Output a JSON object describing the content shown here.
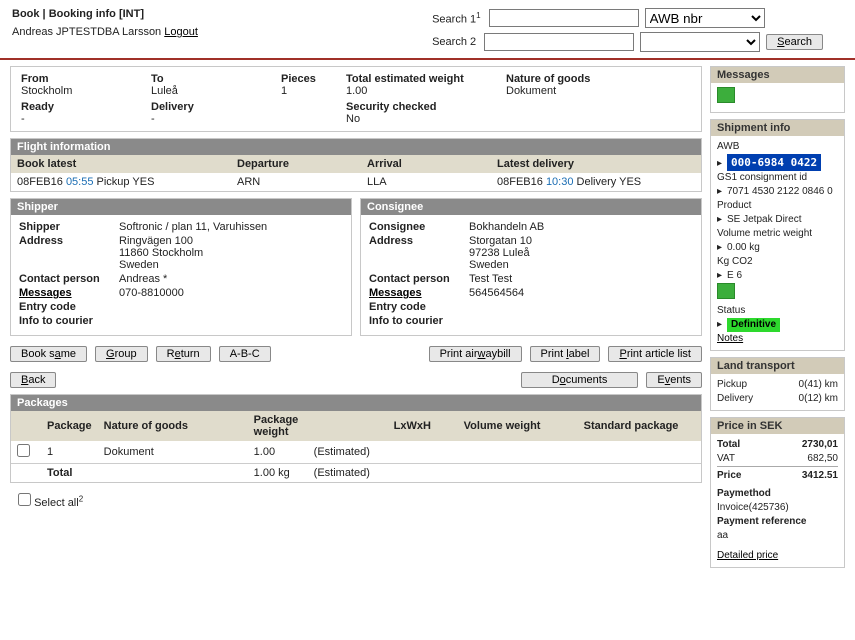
{
  "header": {
    "title": "Book | Booking info [INT]",
    "user": "Andreas JPTESTDBA Larsson",
    "logout": "Logout",
    "search1_label": "Search 1",
    "search2_label": "Search 2",
    "search1_sup": "1",
    "awb_option": "AWB nbr",
    "search_btn": "Search"
  },
  "overview": {
    "from_l": "From",
    "from_v": "Stockholm",
    "to_l": "To",
    "to_v": "Luleå",
    "pieces_l": "Pieces",
    "pieces_v": "1",
    "weight_l": "Total estimated weight",
    "weight_v": "1.00",
    "nature_l": "Nature of goods",
    "nature_v": "Dokument",
    "ready_l": "Ready",
    "ready_v": "-",
    "delivery_l": "Delivery",
    "delivery_v": "-",
    "sec_l": "Security checked",
    "sec_v": "No"
  },
  "flight": {
    "hdr": "Flight information",
    "book_l": "Book latest",
    "dep_l": "Departure",
    "arr_l": "Arrival",
    "lat_l": "Latest delivery",
    "book_date": "08FEB16",
    "book_time": "05:55",
    "book_tail": "Pickup YES",
    "dep_v": "ARN",
    "arr_v": "LLA",
    "lat_date": "08FEB16",
    "lat_time": "10:30",
    "lat_tail": "Delivery YES"
  },
  "shipper": {
    "hdr": "Shipper",
    "shipper_l": "Shipper",
    "shipper_v": "Softronic / plan 11, Varuhissen",
    "addr_l": "Address",
    "addr1": "Ringvägen 100",
    "addr2": "11860 Stockholm",
    "addr3": "Sweden",
    "contact_l": "Contact person",
    "contact_v": "Andreas *",
    "msgs_l": "Messages",
    "phone_v": "070-8810000",
    "entry_l": "Entry code",
    "info_l": "Info to courier"
  },
  "consignee": {
    "hdr": "Consignee",
    "consignee_l": "Consignee",
    "consignee_v": "Bokhandeln AB",
    "addr_l": "Address",
    "addr1": "Storgatan 10",
    "addr2": "97238 Luleå",
    "addr3": "Sweden",
    "contact_l": "Contact person",
    "contact_v": "Test Test",
    "msgs_l": "Messages",
    "phone_v": "564564564",
    "entry_l": "Entry code",
    "info_l": "Info to courier"
  },
  "btns": {
    "booksame": "Book same",
    "group": "Group",
    "return": "Return",
    "abc": "A-B-C",
    "back": "Back",
    "airwaybill": "Print airwaybill",
    "label": "Print label",
    "articles": "Print article list",
    "documents": "Documents",
    "events": "Events"
  },
  "packages": {
    "hdr": "Packages",
    "col_pkg": "Package",
    "col_nat": "Nature of goods",
    "col_wt": "Package weight",
    "col_lwh": "LxWxH",
    "col_vol": "Volume weight",
    "col_std": "Standard package",
    "row_no": "1",
    "row_nat": "Dokument",
    "row_wt": "1.00",
    "row_est": "(Estimated)",
    "tot_l": "Total",
    "tot_wt": "1.00 kg",
    "tot_est": "(Estimated)",
    "selectall": "Select all",
    "selectall_sup": "2"
  },
  "right": {
    "messages_hdr": "Messages",
    "ship_hdr": "Shipment info",
    "awb_l": "AWB",
    "awb_v": " 000-6984 0422 ",
    "gs1_l": "GS1 consignment id",
    "gs1_v": "7071 4530 2122 0846 0",
    "product_l": "Product",
    "product_v": "SE Jetpak Direct",
    "vmw_l": "Volume metric weight",
    "vmw_v": "0.00 kg",
    "co2_l": "Kg CO2",
    "co2_v": "E 6",
    "status_l": "Status",
    "status_v": "Definitive",
    "notes": "Notes",
    "land_hdr": "Land transport",
    "pickup_l": "Pickup",
    "pickup_v": "0(41) km",
    "delivery_l": "Delivery",
    "delivery_v": "0(12) km",
    "price_hdr": "Price in SEK",
    "total_l": "Total",
    "total_v": "2730,01",
    "vat_l": "VAT",
    "vat_v": "682,50",
    "price_l": "Price",
    "price_v": "3412.51",
    "paymethod_l": "Paymethod",
    "paymethod_v": "Invoice(425736)",
    "payref_l": "Payment reference",
    "payref_v": "aa",
    "detailed": "Detailed price"
  }
}
